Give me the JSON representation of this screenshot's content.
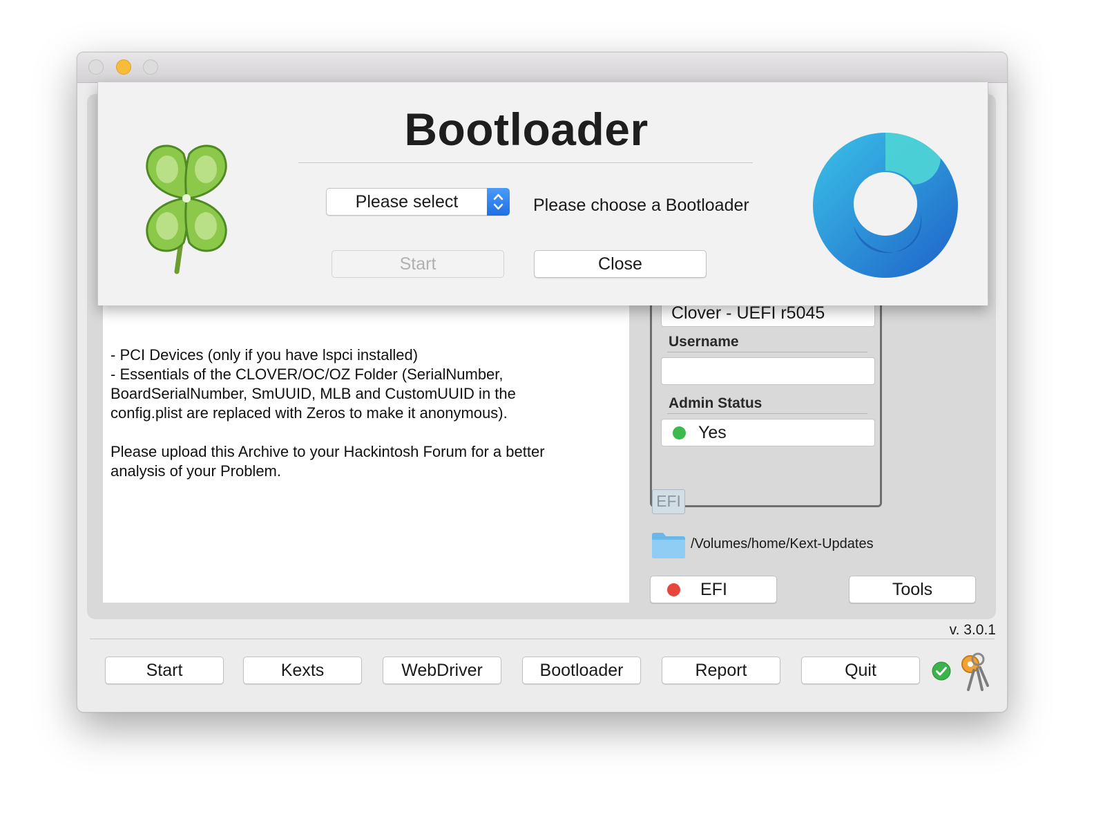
{
  "window": {
    "traffic_lights": [
      "close",
      "minimize",
      "zoom"
    ]
  },
  "log": {
    "lines": [
      "- PCI Devices (only if you have lspci installed)",
      "- Essentials of the CLOVER/OC/OZ Folder (SerialNumber,",
      "BoardSerialNumber, SmUUID, MLB and CustomUUID in the",
      "config.plist are replaced with Zeros to make it anonymous).",
      "",
      "Please upload this Archive to your Hackintosh Forum for a better",
      "analysis of your Problem."
    ]
  },
  "info_panel": {
    "bootloader_value": "Clover - UEFI r5045",
    "username_label": "Username",
    "username_value": "",
    "admin_label": "Admin Status",
    "admin_value": "Yes",
    "admin_status_color": "#3dba4e"
  },
  "efi_badge": "EFI",
  "kext_path": "/Volumes/home/Kext-Updates",
  "efi_button": {
    "label": "EFI",
    "status_color": "#e8453c"
  },
  "tools_button": "Tools",
  "version": "v. 3.0.1",
  "toolbar": {
    "start": "Start",
    "kexts": "Kexts",
    "webdriver": "WebDriver",
    "bootloader": "Bootloader",
    "report": "Report",
    "quit": "Quit"
  },
  "sheet": {
    "title": "Bootloader",
    "select_value": "Please select",
    "select_hint": "Please choose a Bootloader",
    "start_button": "Start",
    "close_button": "Close",
    "left_icon": "clover-icon",
    "right_icon": "opencore-icon"
  },
  "colors": {
    "accent": "#1f6fe6",
    "minimize": "#f6bd39"
  }
}
